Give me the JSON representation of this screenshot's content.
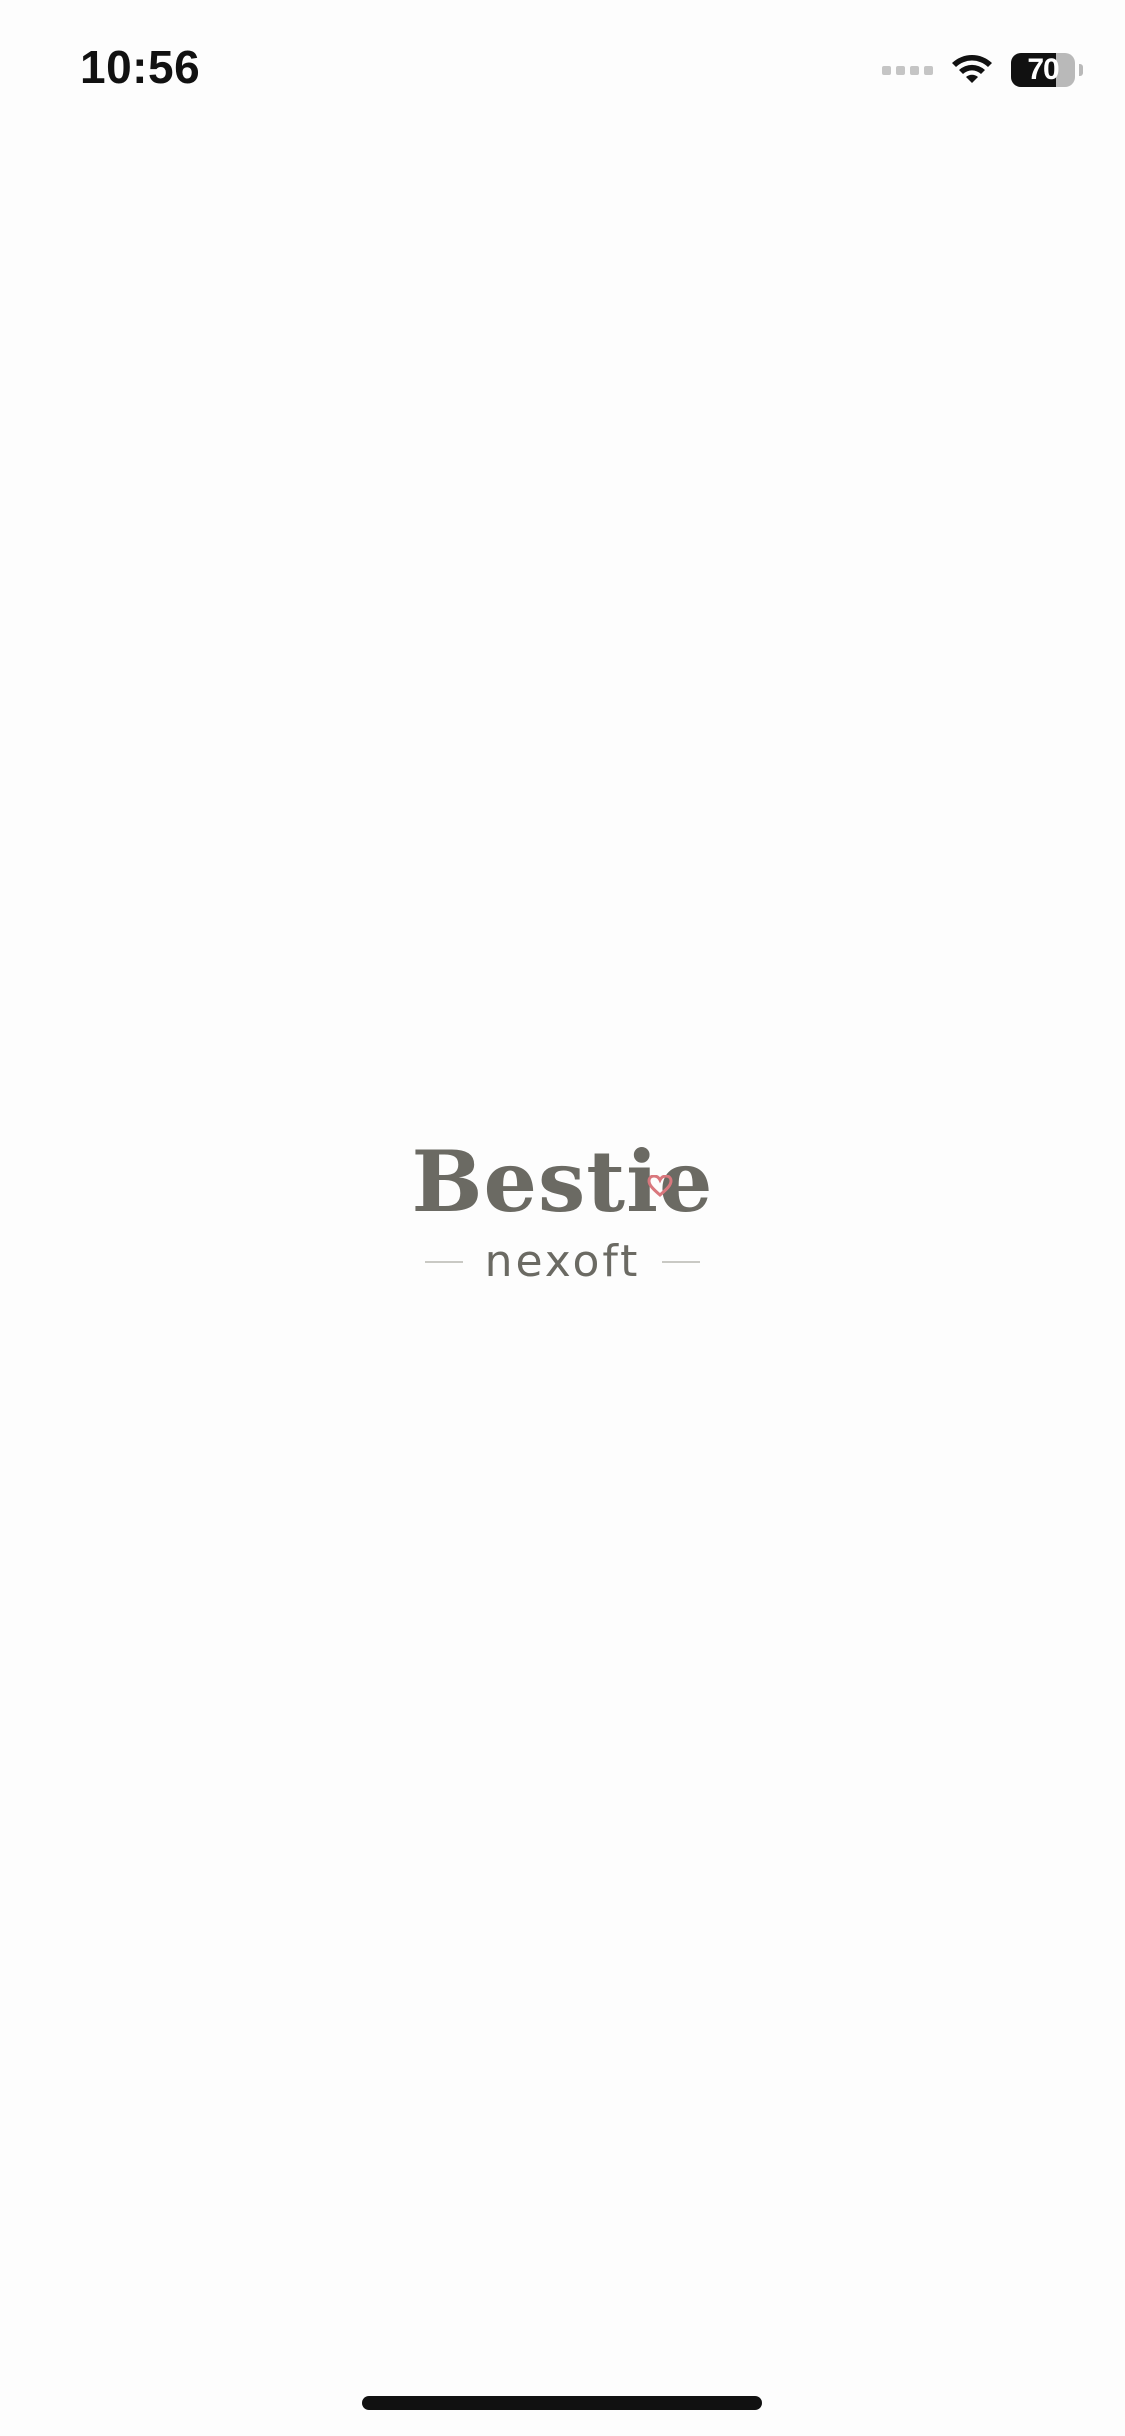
{
  "status_bar": {
    "time": "10:56",
    "battery_level": "70",
    "battery_percent": 70,
    "icons": [
      "cellular-signal-icon",
      "wifi-icon",
      "battery-icon"
    ]
  },
  "splash": {
    "logo_text": "Bestie",
    "subtitle": "nexoft",
    "accent_color": "#d9777d",
    "text_color": "#6b6a63"
  }
}
